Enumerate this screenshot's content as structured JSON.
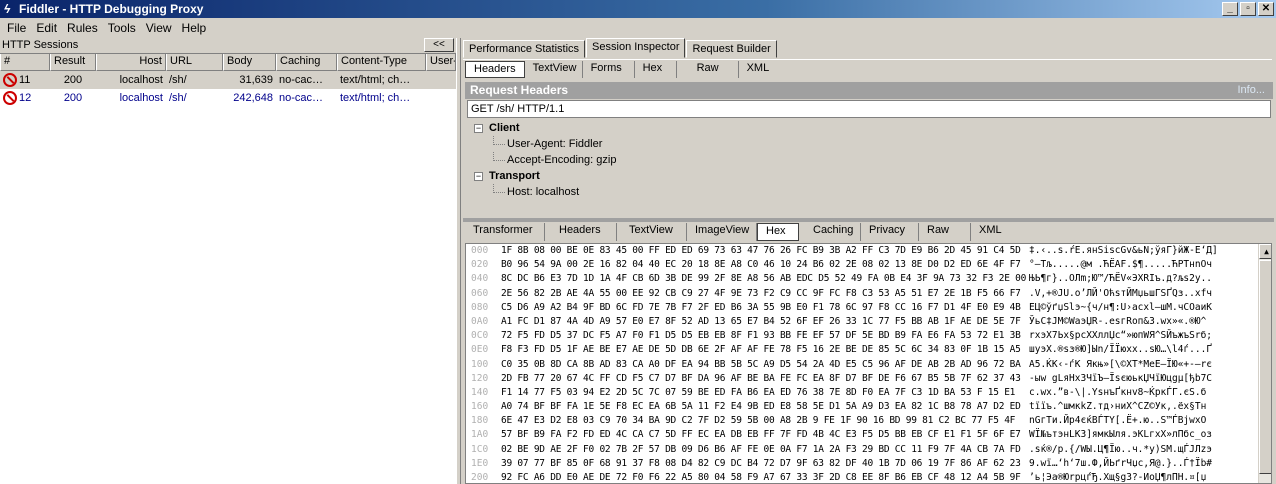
{
  "window": {
    "title": "Fiddler - HTTP Debugging Proxy",
    "app_icon": "lightning-icon",
    "controls": [
      "_",
      "▫",
      "✕"
    ]
  },
  "menu": [
    "File",
    "Edit",
    "Rules",
    "Tools",
    "View",
    "Help"
  ],
  "sessions": {
    "title": "HTTP Sessions",
    "collapse_label": "<<",
    "columns": [
      "#",
      "Result",
      "Host",
      "URL",
      "Body",
      "Caching",
      "Content-Type",
      "User-"
    ],
    "rows": [
      {
        "num": "11",
        "result": "200",
        "host": "localhost",
        "url": "/sh/",
        "body": "31,639",
        "caching": "no-cac…",
        "content_type": "text/html; ch…",
        "user": ""
      },
      {
        "num": "12",
        "result": "200",
        "host": "localhost",
        "url": "/sh/",
        "body": "242,648",
        "caching": "no-cac…",
        "content_type": "text/html; ch…",
        "user": ""
      }
    ]
  },
  "inspector": {
    "top_tabs": [
      "Performance Statistics",
      "Session Inspector",
      "Request Builder"
    ],
    "request_tabs": [
      "Headers",
      "TextView",
      "Forms",
      "Hex",
      "Raw",
      "XML"
    ],
    "request_header_title": "Request Headers",
    "info_link": "Info...",
    "request_line": "GET /sh/ HTTP/1.1",
    "groups": [
      {
        "name": "Client",
        "items": [
          "User-Agent: Fiddler",
          "Accept-Encoding: gzip"
        ]
      },
      {
        "name": "Transport",
        "items": [
          "Host: localhost"
        ]
      }
    ],
    "response_tabs": [
      "Transformer",
      "Headers",
      "TextView",
      "ImageView",
      "Hex",
      "Caching",
      "Privacy",
      "Raw",
      "XML"
    ]
  },
  "hex": {
    "rows": [
      {
        "off": "000",
        "bytes": "1F 8B 08 00 BE 0E 83 45 00 FF ED ED 69 73 63 47 76 26 FC B9 3B A2 FF C3 7D E9 B6 2D 45 91 C4 5D",
        "ascii": "‡.‹..s.ŕE.янSiscGv&ьN;ўяГ}йЖ-E‘Д]"
      },
      {
        "off": "020",
        "bytes": "B0 96 54 9A 00 2E 16 82 04 40 EC 20 18 8E A8 C0 46 10 24 B6 02 2E 08 02 13 8E D0 D2 ED 6E 4F F7",
        "ascii": "°–Tљ.....@м .ЋЁАF.$¶.....ЋРТнnOч"
      },
      {
        "off": "040",
        "bytes": "8C DC B6 E3 7D 1D 1A 4F CB 6D 3B DE 99 2F 8E A8 56 AB EDC D5 52 49 FA 0B E4 3F 9A 73 32 F3 2E 00",
        "ascii": "ЊЬ¶г}..OЛm;Ю™/ЋЁV«ЭХRIъ.д?љs2у.."
      },
      {
        "off": "060",
        "bytes": "2E 56 82 2B AE 4A 55 00 EE 92 CB C9 27 4F 9E 73 F2 C9 CC 9F FC F8 C3 53 A5 51 E7 2E 1B F5 66 F7",
        "ascii": ".V‚+®JU.о’ЛЙ'OћsтЙМџьшГSҐQз..хfч"
      },
      {
        "off": "080",
        "bytes": "C5 D6 A9 A2 B4 9F BD 6C FD 7E 7B F7 2F ED B6 3A 55 9B E0 F1 78 6C 97 F8 CC 16 F7 D1 4F E0 E9 4B",
        "ascii": "ЕЦ©ўґџЅlэ~{ч/н¶:U›асxl—шМ.чСOаиK"
      },
      {
        "off": "0A0",
        "bytes": "A1 FC D1 87 4A 4D A9 57 E0 E7 8F 52 AD 13 65 E7 B4 52 6F EF 26 33 1C 77 F5 BB AB 1F AE DE 5E 7F",
        "ascii": "ЎьС‡JM©WаэЏR-.esгRoп&3.wх»«.®Ю^"
      },
      {
        "off": "0C0",
        "bytes": "72 F5 FD D5 37 DC F5 A7 F0 F1 D5 D5 EB EB 8F F1 93 BB FE EF 57 DF 5E BD B9 FA E6 FA 53 72 E1 3B",
        "ascii": "rхэХ7Ьх§рсХХллЏс“»юпWЯ^ЅЙъжъSrб;"
      },
      {
        "off": "0E0",
        "bytes": "F8 F3 FD D5 1F AE BE E7 AE DE 5D DB 6E 2F AF AF FE 78 F5 16 2E BE DE 85 5C 6C 34 83 0F 1B 15 A5",
        "ascii": "шуэХ.®ѕз®Ю]Ыn/ЇЇюxх..ѕЮ…\\l4ѓ...Ґ"
      },
      {
        "off": "100",
        "bytes": "C0 35 0B 8D CA 8B AD 83 CA A0 DF EA 94 BB 5B 5C A9 D5 54 2A 4D E5 C5 96 AF DE AB 2B AD 96 72 BA",
        "ascii": "А5.ЌК‹-ѓК Якњ»[\\©ХТ*MеЕ–ЇЮ«+-–rє"
      },
      {
        "off": "120",
        "bytes": "2D FB 77 20 67 4C FF CD F5 C7 D7 BF DA 96 AF BE BA FE FC EA 8F D7 BF DE F6 67 B5 5B 7F 62 37 43",
        "ascii": "-ыw gLяНхЗЧїЪ–ЇѕєюькЏЧїЮцgµ[ђb7C"
      },
      {
        "off": "140",
        "bytes": "F1 14 77 F5 03 94 E2 2D 5C 7C 07 59 BE ED FA B6 EA ED 76 38 7E 8D F0 EA 7F C3 1D BA 53 F 15 E1",
        "ascii": "с.wх.”в-\\|.YѕнъҐкнv8~ЌркЃГ.єS.б"
      },
      {
        "off": "160",
        "bytes": "A0 74 BF BF FA 1E 5E F8 EC EA 6B 5A 11 F2 E4 9B ED E8 58 5E D1 5A A9 D3 EA 82 1C B8 78 A7 D2 ED",
        "ascii": " tїїъ.^шмкkZ.тд›ниX^СZ©Ук‚.ёx§Тн"
      },
      {
        "off": "180",
        "bytes": "6E 47 E3 D2 E8 03 C9 70 34 BA 9D C2 7F D2 59 5B 00 A8 2B 9 FE 1F 90 16 BD 99 81 C2 BC 77 F5 4F",
        "ascii": "nGгТи.Йp4єќВЃТY[.Ё+.ю..Ѕ™ЃВјwхO"
      },
      {
        "off": "1A0",
        "bytes": "57 BF B9 FA F2 FD ED 4C CA C7 5D FF EC EA DB EB FF 7F FD 4B 4C E3 F5 D5 BB EB CF E1 F1 5F 6F E7",
        "ascii": "WЇ№ътэнLКЗ]ямкЫля.эKLгхХ»лПбс_oз"
      },
      {
        "off": "1C0",
        "bytes": "02 BE 9D AE 2F F0 02 7B 2F 57 DB 09 D6 B6 AF FE 0E 0A F7 1A 2A F3 29 BD CC 11 F9 7F 4A CB 7A FD",
        "ascii": ".ѕќ®/р.{/WЫ.Ц¶Їю..ч.*у)ЅМ.щЃJЛzэ"
      },
      {
        "off": "1E0",
        "bytes": "39 07 77 BF 85 0F 68 91 37 F8 08 D4 82 C9 DC B4 72 D7 9F 63 82 DF 40 1B 7D 06 19 7F 86 AF 62 23",
        "ascii": "9.wї…‘h‘7ш.Ф‚ЙЬґrЧџc‚Я@.}..Ѓ†Їb#"
      },
      {
        "off": "200",
        "bytes": "92 FC A6 DD E0 AE DE 72 F0 F6 22 A5 80 04 58 F9 A7 67 33 3F 2D C8 EE 8F B6 EB CF 48 12 A4 5B 9F",
        "ascii": "’ь¦Эа®ЮrрцѓЂ.Xщ§g3?-ИоЏ¶лПH.¤[џ"
      }
    ]
  }
}
